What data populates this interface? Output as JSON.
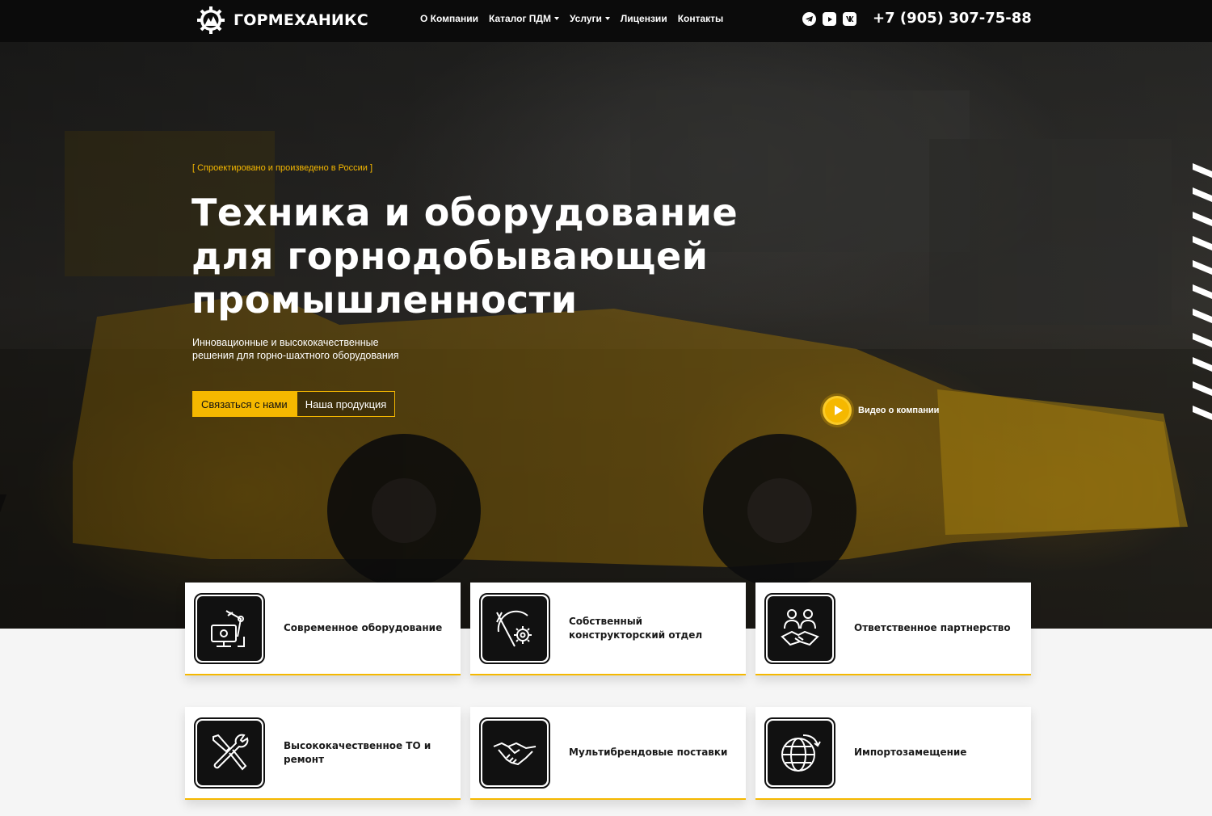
{
  "header": {
    "logo_text": "ГОРМЕХАНИКС",
    "nav": [
      {
        "label": "О Компании",
        "dropdown": false
      },
      {
        "label": "Каталог ПДМ",
        "dropdown": true
      },
      {
        "label": "Услуги",
        "dropdown": true
      },
      {
        "label": "Лицензии",
        "dropdown": false
      },
      {
        "label": "Контакты",
        "dropdown": false
      }
    ],
    "socials": [
      "telegram-icon",
      "youtube-icon",
      "vk-icon"
    ],
    "phone": "+7 (905) 307-75-88"
  },
  "hero": {
    "tagline": "[ Спроектировано и произведено в России ]",
    "title_lines": [
      "Техника и оборудование",
      "для горнодобывающей",
      "промышленности"
    ],
    "subtitle_lines": [
      "Инновационные и высококачественные",
      "решения для горно-шахтного оборудования"
    ],
    "btn_contact": "Связаться с нами",
    "btn_products": "Наша продукция",
    "video_label": "Видео о компании"
  },
  "features": [
    {
      "label": "Современное оборудование",
      "icon": "robot-arm-monitor-icon"
    },
    {
      "label": "Собственный конструкторский отдел",
      "icon": "design-gear-icon"
    },
    {
      "label": "Ответственное партнерство",
      "icon": "partners-handshake-icon"
    },
    {
      "label": "Высококачественное ТО и ремонт",
      "icon": "wrench-screwdriver-icon"
    },
    {
      "label": "Мультибрендовые поставки",
      "icon": "handshake-icon"
    },
    {
      "label": "Импортозамещение",
      "icon": "globe-arrow-icon"
    }
  ],
  "colors": {
    "accent": "#f5b800",
    "header_bg": "#0b0b0b",
    "page_bg": "#f5f5f5"
  }
}
